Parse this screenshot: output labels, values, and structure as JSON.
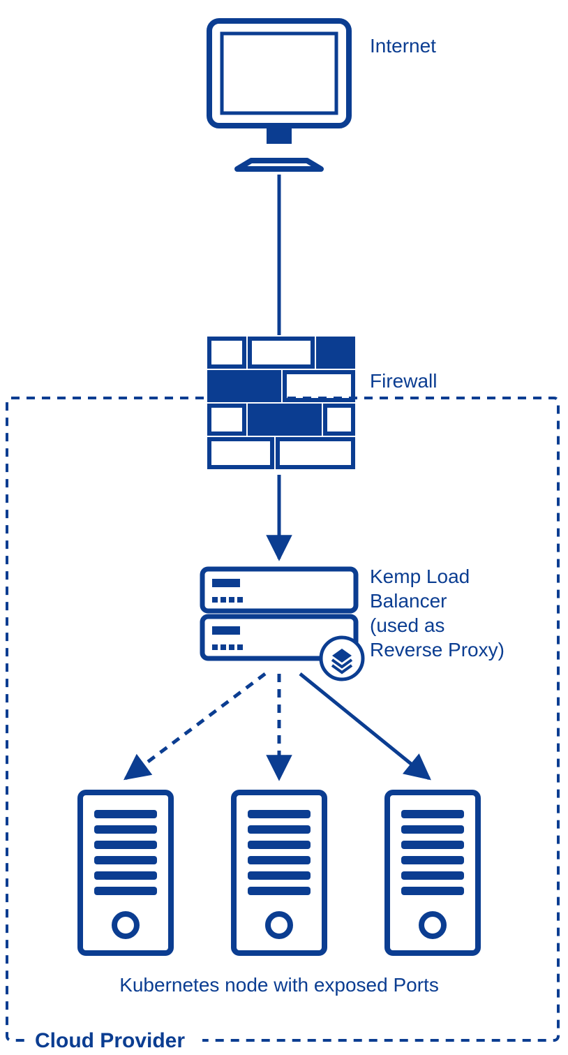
{
  "colors": {
    "stroke": "#0b3d91",
    "fill": "#0b3d91",
    "bg": "#ffffff"
  },
  "labels": {
    "internet": "Internet",
    "firewall": "Firewall",
    "lb_line1": "Kemp Load",
    "lb_line2": "Balancer",
    "lb_line3": "(used as",
    "lb_line4": "Reverse Proxy)",
    "nodes_caption": "Kubernetes node with exposed Ports",
    "box_label": "Cloud Provider"
  },
  "diagram": {
    "nodes": [
      {
        "id": "internet",
        "type": "client",
        "label": "Internet"
      },
      {
        "id": "firewall",
        "type": "firewall",
        "label": "Firewall"
      },
      {
        "id": "lb",
        "type": "load-balancer",
        "label": "Kemp Load Balancer (used as Reverse Proxy)"
      },
      {
        "id": "k8s-node-1",
        "type": "server",
        "label": "Kubernetes node with exposed Ports"
      },
      {
        "id": "k8s-node-2",
        "type": "server",
        "label": "Kubernetes node with exposed Ports"
      },
      {
        "id": "k8s-node-3",
        "type": "server",
        "label": "Kubernetes node with exposed Ports"
      }
    ],
    "edges": [
      {
        "from": "internet",
        "to": "firewall",
        "style": "solid",
        "arrow": false
      },
      {
        "from": "firewall",
        "to": "lb",
        "style": "solid",
        "arrow": true
      },
      {
        "from": "lb",
        "to": "k8s-node-1",
        "style": "dashed",
        "arrow": true
      },
      {
        "from": "lb",
        "to": "k8s-node-2",
        "style": "dashed",
        "arrow": true
      },
      {
        "from": "lb",
        "to": "k8s-node-3",
        "style": "solid",
        "arrow": true
      }
    ],
    "container": {
      "id": "cloud-provider",
      "label": "Cloud Provider",
      "contains": [
        "lb",
        "k8s-node-1",
        "k8s-node-2",
        "k8s-node-3"
      ],
      "partially_contains": [
        "firewall"
      ]
    }
  }
}
